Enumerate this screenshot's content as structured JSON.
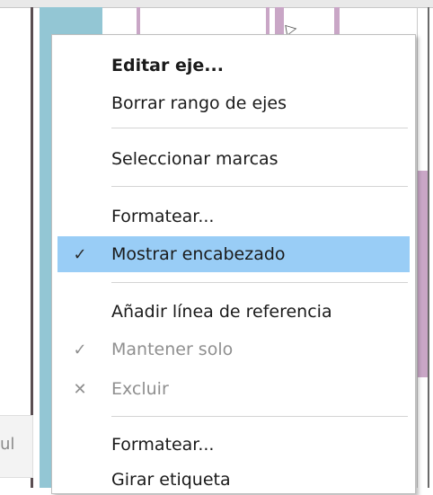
{
  "menu": {
    "items": [
      {
        "label": "Editar eje...",
        "check": ""
      },
      {
        "label": "Borrar rango de ejes",
        "check": ""
      },
      {
        "label": "Seleccionar marcas",
        "check": ""
      },
      {
        "label": "Formatear...",
        "check": ""
      },
      {
        "label": "Mostrar encabezado",
        "check": "✓"
      },
      {
        "label": "Añadir línea de referencia",
        "check": ""
      },
      {
        "label": "Mantener solo",
        "check": "✓"
      },
      {
        "label": "Excluir",
        "check": "✕"
      },
      {
        "label": "Formatear...",
        "check": ""
      },
      {
        "label": "Girar etiqueta",
        "check": ""
      }
    ]
  },
  "background": {
    "side_text": "ul"
  },
  "colors": {
    "highlight": "#99cdf6",
    "teal_bar": "#93c6d4",
    "purple_bar": "#c9a6c6"
  }
}
